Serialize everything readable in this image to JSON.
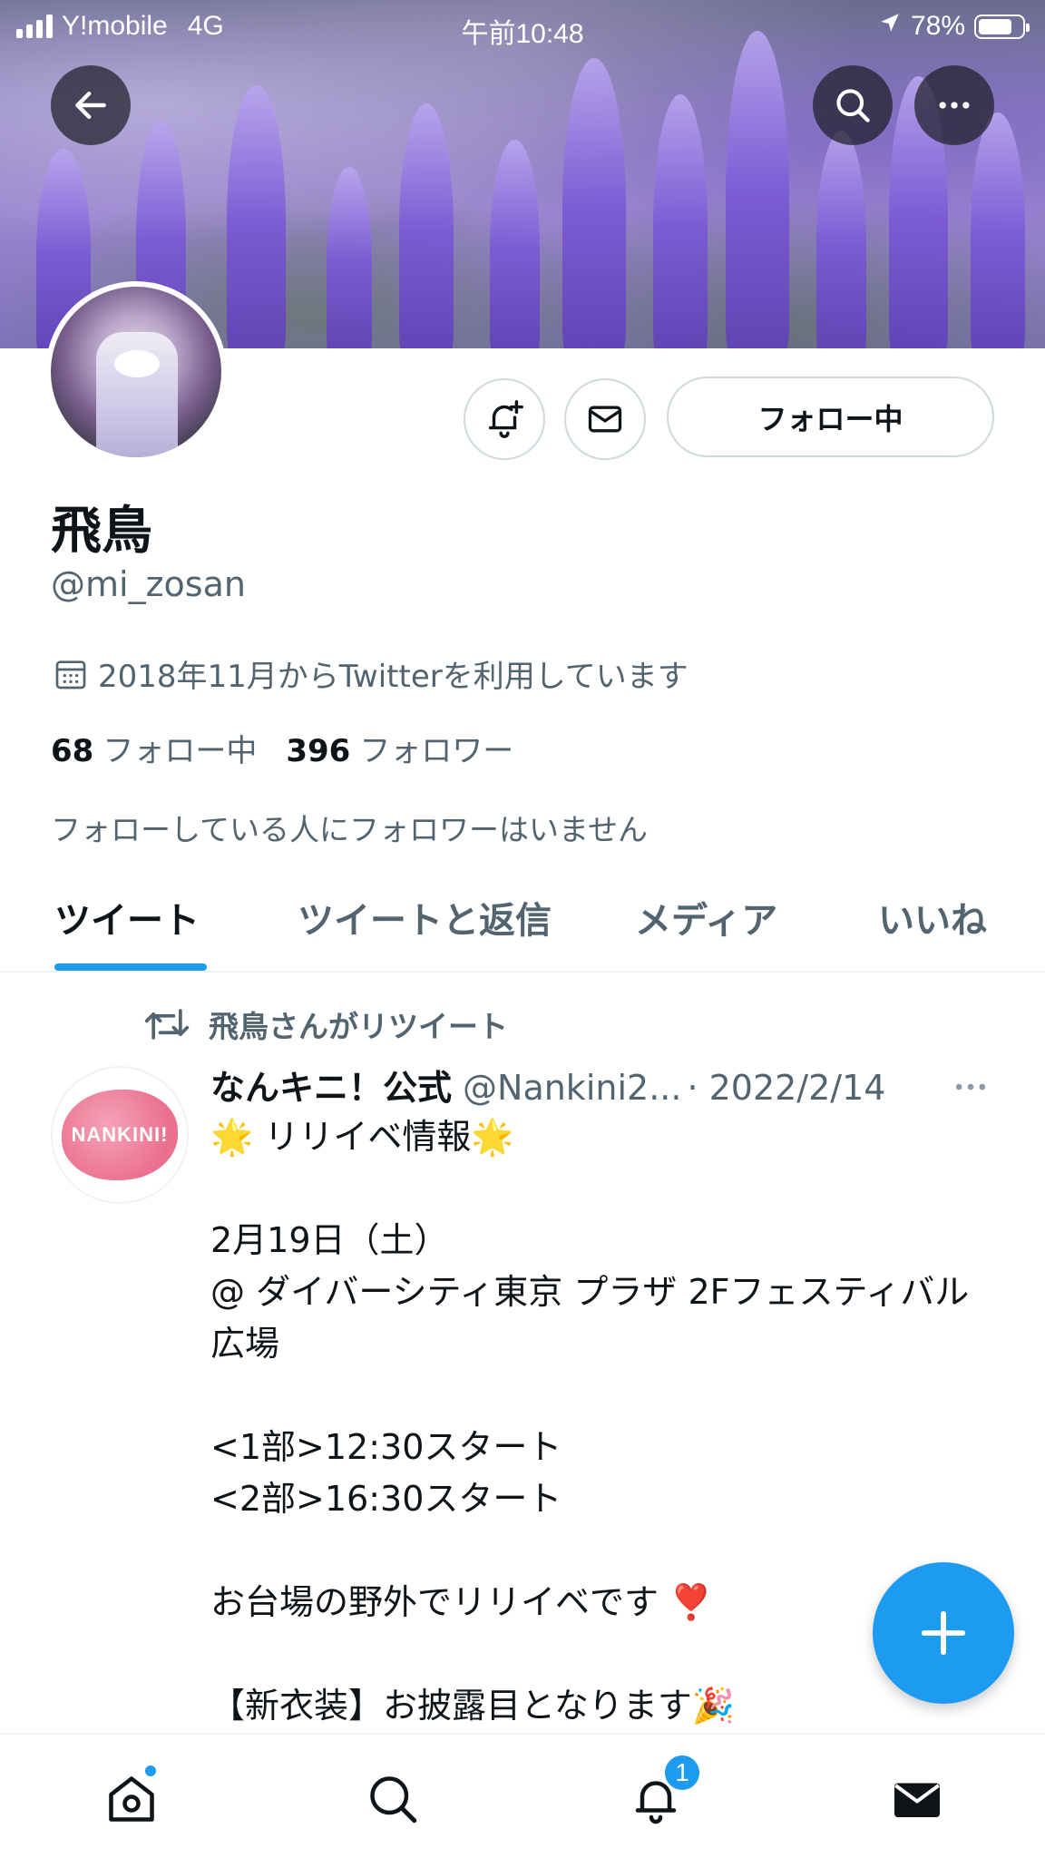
{
  "status_bar": {
    "carrier": "Y!mobile",
    "network": "4G",
    "time": "午前10:48",
    "battery": "78%",
    "battery_level": 0.78
  },
  "profile": {
    "name": "飛鳥",
    "handle": "@mi_zosan",
    "joined": "2018年11月からTwitterを利用しています",
    "following_count": "68",
    "following_label": "フォロー中",
    "followers_count": "396",
    "followers_label": "フォロワー",
    "no_shared_followers": "フォローしている人にフォロワーはいません",
    "follow_button": "フォロー中"
  },
  "tabs": [
    {
      "label": "ツイート",
      "active": true
    },
    {
      "label": "ツイートと返信",
      "active": false
    },
    {
      "label": "メディア",
      "active": false
    },
    {
      "label": "いいね",
      "active": false
    }
  ],
  "tweet": {
    "retweet_label": "飛鳥さんがリツイート",
    "author_name": "なんキニ！公式",
    "author_handle": "@Nankini2...",
    "date": "· 2022/2/14",
    "avatar_text": "NANKINI!",
    "body": "🌟 リリイベ情報🌟\n\n2月19日（土）\n@ ダイバーシティ東京 プラザ 2Fフェスティバル広場\n\n<1部>12:30スタート\n<2部>16:30スタート\n\nお台場の野外でリリイベです ❣️\n\n【新衣装】お披露目となります🎉"
  },
  "bottom_nav": {
    "notifications_badge": "1",
    "home_has_dot": true
  },
  "colors": {
    "accent": "#1d9bf0",
    "secondary_text": "#536471",
    "primary_text": "#0f1419"
  }
}
